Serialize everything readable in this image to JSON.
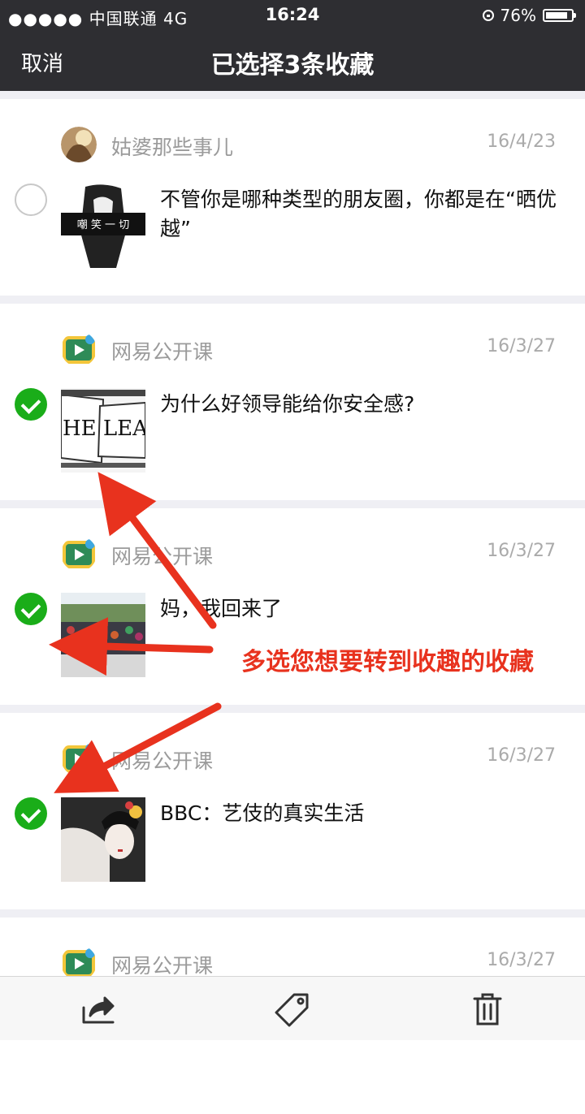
{
  "status_bar": {
    "carrier": "●●●●● 中国联通 4G",
    "time": "16:24",
    "battery_percent": "76%",
    "battery_level": 0.76
  },
  "nav": {
    "cancel_label": "取消",
    "title": "已选择3条收藏"
  },
  "items": [
    {
      "source": "姑婆那些事儿",
      "date": "16/4/23",
      "text": "不管你是哪种类型的朋友圈，你都是在“晒优越”",
      "selected": false,
      "thumb_text": "嘲 笑 一 切"
    },
    {
      "source": "网易公开课",
      "date": "16/3/27",
      "text": "为什么好领导能给你安全感?",
      "selected": true,
      "thumb_text": "HE LEAD"
    },
    {
      "source": "网易公开课",
      "date": "16/3/27",
      "text": "妈，我回来了",
      "selected": true
    },
    {
      "source": "网易公开课",
      "date": "16/3/27",
      "text": "BBC：艺伎的真实生活",
      "selected": true
    },
    {
      "source": "网易公开课",
      "date": "16/3/27"
    }
  ],
  "annotation": "多选您想要转到收趣的收藏",
  "toolbar": {
    "icons": [
      "share-icon",
      "tag-icon",
      "trash-icon"
    ]
  },
  "colors": {
    "header_bg": "#2e2e32",
    "check_green": "#1aad19",
    "annotation_red": "#e8321e"
  }
}
